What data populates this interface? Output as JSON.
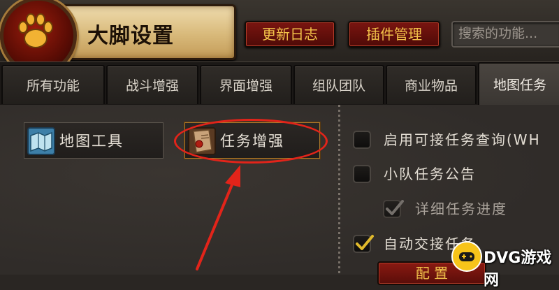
{
  "header": {
    "title": "大脚设置",
    "changelog_button": "更新日志",
    "plugin_button": "插件管理",
    "search_placeholder": "搜索的功能..."
  },
  "tabs": [
    {
      "label": "所有功能",
      "active": false
    },
    {
      "label": "战斗增强",
      "active": false
    },
    {
      "label": "界面增强",
      "active": false
    },
    {
      "label": "组队团队",
      "active": false
    },
    {
      "label": "商业物品",
      "active": false
    },
    {
      "label": "地图任务",
      "active": true
    }
  ],
  "subcategories": [
    {
      "label": "地图工具",
      "selected": false,
      "icon": "map-icon"
    },
    {
      "label": "任务增强",
      "selected": true,
      "icon": "quest-scroll-icon"
    }
  ],
  "options": [
    {
      "label": "启用可接任务查询(WH",
      "checked": false
    },
    {
      "label": "小队任务公告",
      "checked": false
    },
    {
      "label": "详细任务进度",
      "checked": true,
      "enabled": false
    },
    {
      "label": "自动交接任务",
      "checked": true
    }
  ],
  "config_button": "配 置",
  "watermark": {
    "text": "DVG游戏网"
  },
  "colors": {
    "accent_gold": "#f3c24a",
    "button_red": "#7a1510",
    "annotation_red": "#e2241a"
  }
}
